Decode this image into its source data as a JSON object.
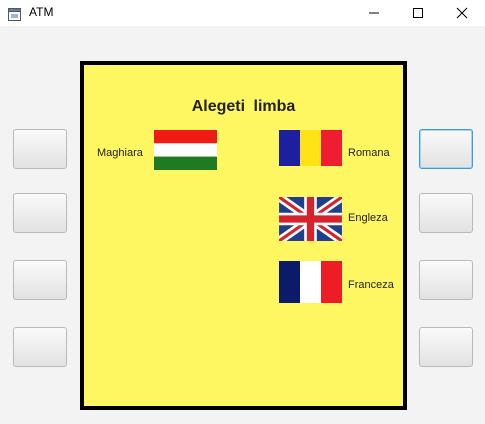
{
  "window": {
    "title": "ATM",
    "icon": "app-window-icon",
    "controls": [
      "minimize-icon",
      "maximize-icon",
      "close-icon"
    ]
  },
  "screen": {
    "heading": "Alegeti  limba",
    "background": "#fff761",
    "languages": [
      {
        "label": "Maghiara",
        "flag": "hungary-flag-icon"
      },
      {
        "label": "Romana",
        "flag": "romania-flag-icon"
      },
      {
        "label": "Engleza",
        "flag": "uk-flag-icon"
      },
      {
        "label": "Franceza",
        "flag": "france-flag-icon"
      }
    ]
  },
  "side_buttons": {
    "left": [
      "",
      "",
      "",
      ""
    ],
    "right": [
      "",
      "",
      "",
      ""
    ],
    "focused": "right-1"
  },
  "colors": {
    "focus_border": "#3d9bd8",
    "screen_border": "#000000"
  }
}
